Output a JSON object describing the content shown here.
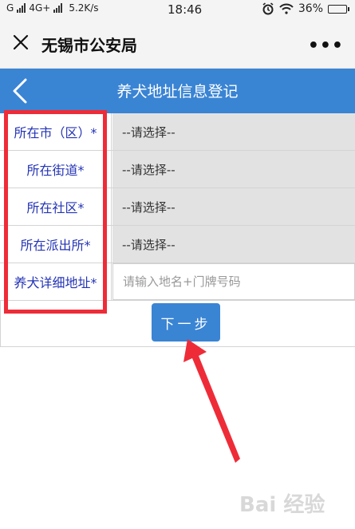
{
  "status_bar": {
    "carrier": "G",
    "network": "4G+",
    "speed": "5.2K/s",
    "time": "18:46",
    "battery": "36%",
    "battery_level": 0.36
  },
  "wechat_bar": {
    "title": "无锡市公安局",
    "close_icon": "close-icon",
    "more_icon": "more-icon",
    "more_glyph": "•••"
  },
  "app_header": {
    "title": "养犬地址信息登记",
    "back_icon": "back-icon"
  },
  "form": {
    "fields": [
      {
        "label": "所在市（区）*",
        "type": "select",
        "value": "--请选择--"
      },
      {
        "label": "所在街道*",
        "type": "select",
        "value": "--请选择--"
      },
      {
        "label": "所在社区*",
        "type": "select",
        "value": "--请选择--"
      },
      {
        "label": "所在派出所*",
        "type": "select",
        "value": "--请选择--"
      },
      {
        "label": "养犬详细地址*",
        "type": "input",
        "value": "",
        "placeholder": "请输入地名+门牌号码"
      }
    ],
    "next_button": "下一步"
  },
  "colors": {
    "accent": "#3a84d4",
    "label_text": "#2434b6",
    "annotation_red": "#ee2c38"
  },
  "watermark": "Bai 经验"
}
